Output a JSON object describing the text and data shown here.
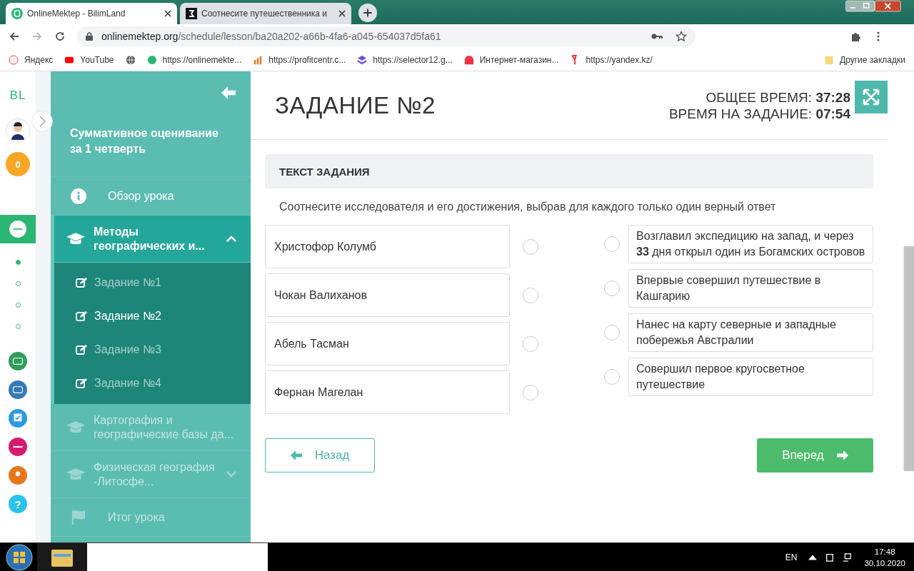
{
  "browser": {
    "tabs": [
      {
        "title": "OnlineMektep - BilimLand",
        "selected": true
      },
      {
        "title": "Соотнесите путешественника и",
        "selected": false
      }
    ],
    "url_host": "onlinemektep.org",
    "url_path": "/schedule/lesson/ba20a202-a66b-4fa6-a045-654037d5fa61",
    "bookmarks": [
      "Яндекс",
      "YouTube",
      "https://onlinemekte...",
      "https://profitcentr.c...",
      "https://selector12.g...",
      "Интернет-магазин...",
      "https://yandex.kz/"
    ],
    "other_bookmarks": "Другие закладки"
  },
  "rail": {
    "logo": "BL",
    "badge": "0",
    "steps": [
      {
        "selected": true
      },
      {
        "selected": false
      },
      {
        "selected": false
      },
      {
        "selected": false
      }
    ],
    "help": "?"
  },
  "sidebar": {
    "title": "Суммативное оценивание за 1 четверть",
    "items": [
      {
        "kind": "overview",
        "label": "Обзор урока",
        "disabled": false
      },
      {
        "kind": "section",
        "label": "Методы географических и...",
        "expanded": true,
        "disabled": false,
        "children": [
          {
            "label": "Задание №1",
            "selected": false
          },
          {
            "label": "Задание №2",
            "selected": true
          },
          {
            "label": "Задание №3",
            "selected": false
          },
          {
            "label": "Задание №4",
            "selected": false
          }
        ]
      },
      {
        "kind": "section",
        "label": "Картография и географические базы да...",
        "expanded": false,
        "disabled": true
      },
      {
        "kind": "section",
        "label": "Физическая география -Литосфе...",
        "expanded": false,
        "disabled": true,
        "has_children": true
      },
      {
        "kind": "final",
        "label": "Итог урока",
        "disabled": true
      }
    ]
  },
  "task": {
    "title": "ЗАДАНИЕ №2",
    "timers": [
      {
        "label": "ОБЩЕЕ ВРЕМЯ:",
        "value": "37:28"
      },
      {
        "label": "ВРЕМЯ НА ЗАДАНИЕ:",
        "value": "07:54"
      }
    ],
    "section_heading": "ТЕКСТ ЗАДАНИЯ",
    "instruction": "Соотнесите исследователя и его достижения, выбрав для каждого только один верный ответ",
    "left": [
      {
        "text": "Христофор Колумб",
        "checked": false
      },
      {
        "text": "Чокан Валиханов",
        "checked": false
      },
      {
        "text": "Абель Тасман",
        "checked": false
      },
      {
        "text": "Фернан Магелан",
        "checked": false
      }
    ],
    "right": [
      {
        "text": "Возглавил экспедицию на запад, и через **33** дня открыл один из Богамских островов",
        "checked": false
      },
      {
        "text": "Впервые совершил путешествие в Кашгарию",
        "checked": false
      },
      {
        "text": "Нанес на карту северные и западные побережья Австралии",
        "checked": false
      },
      {
        "text": "Совершил первое кругосветное путешествие",
        "checked": false
      }
    ],
    "back": "Назад",
    "next": "Вперед"
  },
  "taskbar": {
    "lang": "EN",
    "time": "17:48",
    "date": "30.10.2020"
  }
}
